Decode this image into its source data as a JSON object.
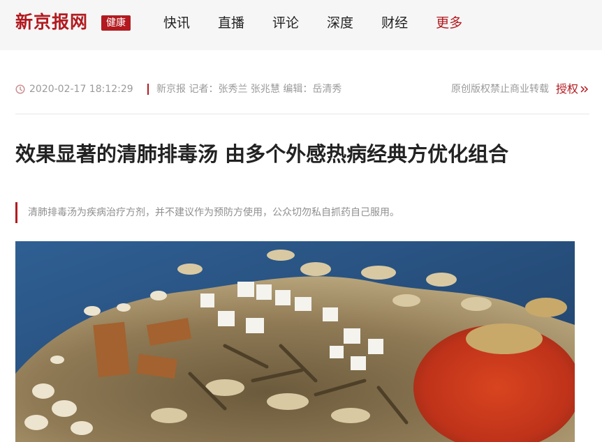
{
  "header": {
    "logo_text": "新京报网",
    "channel_badge": "健康",
    "nav": [
      {
        "label": "快讯"
      },
      {
        "label": "直播"
      },
      {
        "label": "评论"
      },
      {
        "label": "深度"
      },
      {
        "label": "财经"
      },
      {
        "label": "更多"
      }
    ]
  },
  "article": {
    "datetime": "2020-02-17 18:12:29",
    "source": "新京报 记者：张秀兰 张兆慧 编辑：岳清秀",
    "copyright": "原创版权禁止商业转载",
    "license_link": "授权",
    "title": "效果显著的清肺排毒汤 由多个外感热病经典方优化组合",
    "summary": "清肺排毒汤为疾病治疗方剂，并不建议作为预防方使用，公众切勿私自抓药自己服用。"
  },
  "colors": {
    "accent": "#b21a20",
    "nav_bg": "#f5f6f5"
  },
  "icons": {
    "time": "clock-icon",
    "license": "double-chevron-icon"
  }
}
